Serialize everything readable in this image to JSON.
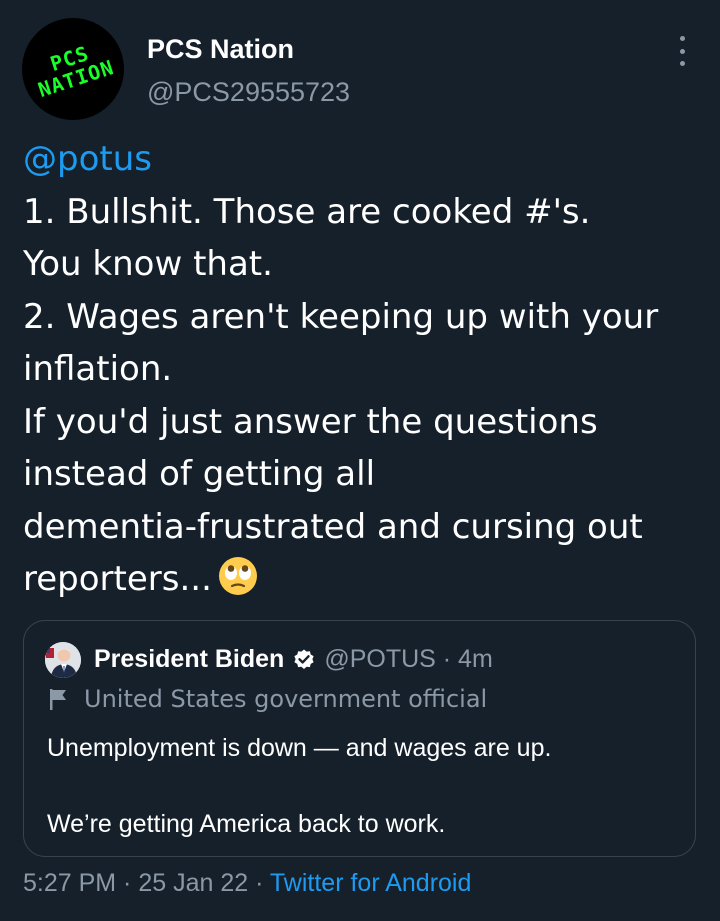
{
  "tweet": {
    "author": {
      "name": "PCS Nation",
      "handle": "@PCS29555723",
      "avatar_text": [
        "PCS",
        "NATION"
      ]
    },
    "more_icon": "more-vertical-icon",
    "body": {
      "mention": "@potus",
      "lines": [
        "1. Bullshit. Those are cooked #'s.",
        "You know that.",
        "2. Wages aren't keeping up with your",
        "inflation.",
        "If you'd just answer the questions",
        "instead of getting all",
        "dementia-frustrated and cursing out",
        "reporters..."
      ],
      "emoji": "face-with-rolling-eyes-emoji"
    },
    "timestamp": "5:27 PM · 25 Jan 22 · ",
    "source": "Twitter for Android"
  },
  "quoted_tweet": {
    "name": "President Biden",
    "handle": "@POTUS · 4m",
    "label": "United States government official",
    "text": [
      "Unemployment is down — and wages are up.",
      "We’re getting America back to work."
    ]
  },
  "colors": {
    "background": "#15202b",
    "text": "#ffffff",
    "secondary": "#8b98a5",
    "accent": "#1d9bf0",
    "border": "#38444d",
    "logo_green": "#19ff29"
  }
}
